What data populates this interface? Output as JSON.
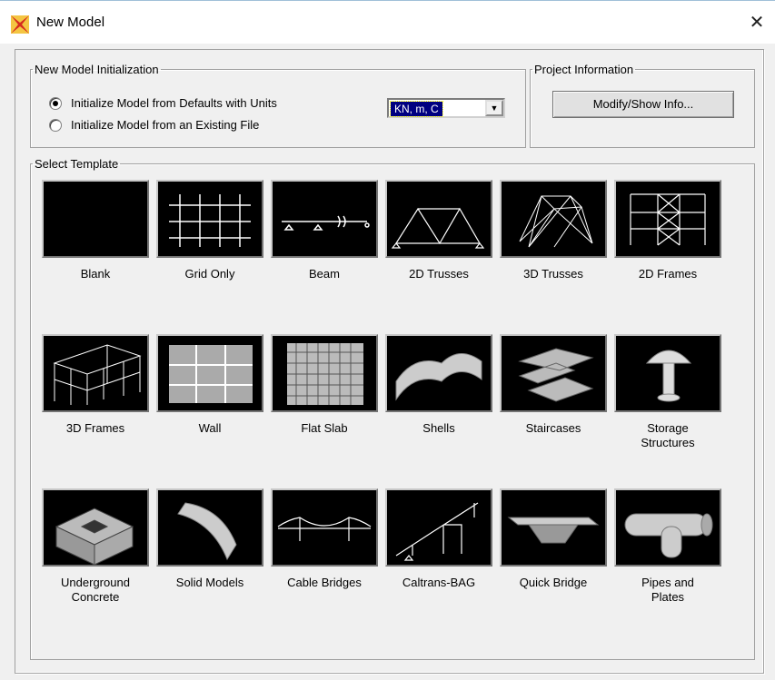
{
  "window": {
    "title": "New Model",
    "close_glyph": "✕"
  },
  "init_group": {
    "legend": "New Model Initialization",
    "option_defaults": "Initialize Model from Defaults with Units",
    "option_file": "Initialize Model  from an Existing File",
    "selected_option": "defaults",
    "units_value": "KN, m, C",
    "dropdown_glyph": "▼"
  },
  "project_group": {
    "legend": "Project Information",
    "button": "Modify/Show Info..."
  },
  "template_group": {
    "legend": "Select Template",
    "tiles": [
      {
        "label": "Blank",
        "icon": "blank-icon"
      },
      {
        "label": "Grid Only",
        "icon": "grid-icon"
      },
      {
        "label": "Beam",
        "icon": "beam-icon"
      },
      {
        "label": "2D Trusses",
        "icon": "2d-truss-icon"
      },
      {
        "label": "3D Trusses",
        "icon": "3d-truss-icon"
      },
      {
        "label": "2D Frames",
        "icon": "2d-frame-icon"
      },
      {
        "label": "3D Frames",
        "icon": "3d-frame-icon"
      },
      {
        "label": "Wall",
        "icon": "wall-icon"
      },
      {
        "label": "Flat Slab",
        "icon": "flat-slab-icon"
      },
      {
        "label": "Shells",
        "icon": "shells-icon"
      },
      {
        "label": "Staircases",
        "icon": "staircase-icon"
      },
      {
        "label": "Storage\nStructures",
        "icon": "storage-structure-icon"
      },
      {
        "label": "Underground\nConcrete",
        "icon": "underground-concrete-icon"
      },
      {
        "label": "Solid Models",
        "icon": "solid-model-icon"
      },
      {
        "label": "Cable Bridges",
        "icon": "cable-bridge-icon"
      },
      {
        "label": "Caltrans-BAG",
        "icon": "caltrans-bag-icon"
      },
      {
        "label": "Quick Bridge",
        "icon": "quick-bridge-icon"
      },
      {
        "label": "Pipes and\nPlates",
        "icon": "pipes-plates-icon"
      }
    ]
  }
}
